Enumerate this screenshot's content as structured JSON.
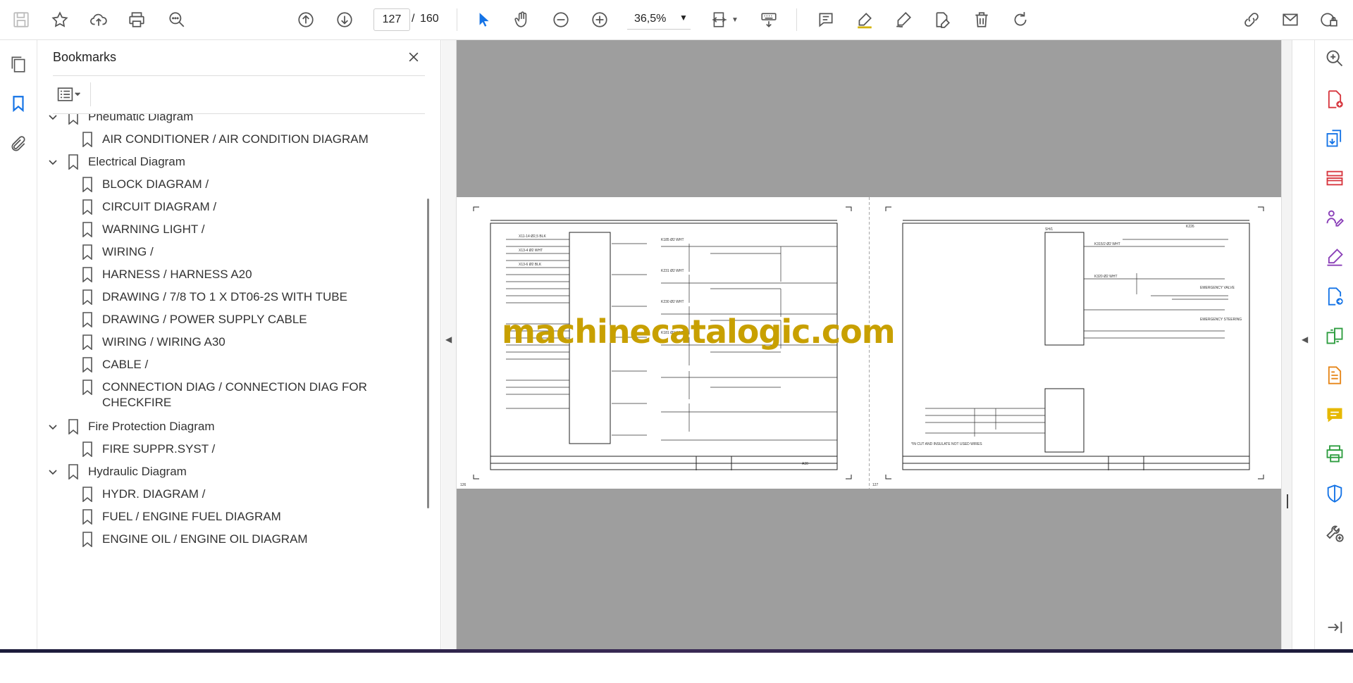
{
  "toolbar": {
    "page_current": "127",
    "page_separator": "/",
    "page_total": "160",
    "zoom": "36,5%"
  },
  "bookmarks": {
    "title": "Bookmarks",
    "items": [
      {
        "label": "Pneumatic Diagram",
        "level": 0,
        "expanded": true
      },
      {
        "label": "AIR CONDITIONER / AIR CONDITION DIAGRAM",
        "level": 1
      },
      {
        "label": "Electrical Diagram",
        "level": 0,
        "expanded": true
      },
      {
        "label": "BLOCK DIAGRAM /",
        "level": 1
      },
      {
        "label": "CIRCUIT DIAGRAM /",
        "level": 1
      },
      {
        "label": "WARNING LIGHT /",
        "level": 1
      },
      {
        "label": "WIRING /",
        "level": 1
      },
      {
        "label": "HARNESS / HARNESS A20",
        "level": 1
      },
      {
        "label": "DRAWING / 7/8 TO 1 X DT06-2S WITH TUBE",
        "level": 1
      },
      {
        "label": "DRAWING / POWER SUPPLY CABLE",
        "level": 1
      },
      {
        "label": "WIRING / WIRING A30",
        "level": 1
      },
      {
        "label": "CABLE /",
        "level": 1
      },
      {
        "label": "CONNECTION DIAG / CONNECTION DIAG FOR CHECKFIRE",
        "level": 1
      },
      {
        "label": "Fire Protection Diagram",
        "level": 0,
        "expanded": true
      },
      {
        "label": "FIRE SUPPR.SYST /",
        "level": 1
      },
      {
        "label": "Hydraulic Diagram",
        "level": 0,
        "expanded": true
      },
      {
        "label": "HYDR. DIAGRAM /",
        "level": 1
      },
      {
        "label": "FUEL / ENGINE FUEL DIAGRAM",
        "level": 1
      },
      {
        "label": "ENGINE OIL / ENGINE OIL DIAGRAM",
        "level": 1
      }
    ]
  },
  "document": {
    "watermark": "machinecatalogic.com",
    "left_page_number": "126",
    "right_page_number": "127"
  },
  "colors": {
    "accent": "#1473e6",
    "doc_background": "#9e9e9e",
    "watermark": "#c8a000"
  }
}
